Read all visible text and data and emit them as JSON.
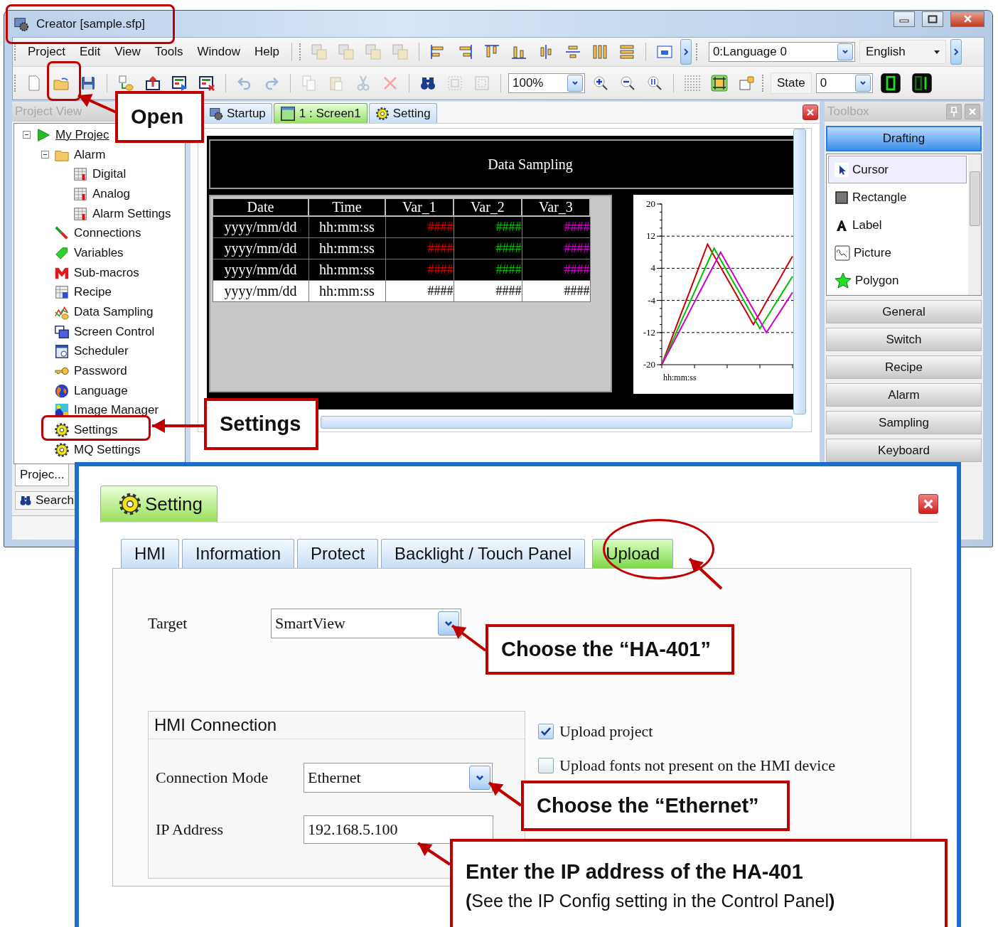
{
  "window": {
    "title": "Creator [sample.sfp]"
  },
  "menu": [
    "Project",
    "Edit",
    "View",
    "Tools",
    "Window",
    "Help"
  ],
  "language_select": {
    "value": "0:Language 0"
  },
  "locale_select": {
    "value": "English"
  },
  "zoom_select": {
    "value": "100%"
  },
  "state_select": {
    "label": "State",
    "value": "0"
  },
  "project_view": {
    "title": "Project View",
    "tree": [
      {
        "label": "My Projec",
        "expanded": true,
        "children": [
          {
            "label": "Alarm",
            "expanded": true,
            "children": [
              {
                "label": "Digital"
              },
              {
                "label": "Analog"
              },
              {
                "label": "Alarm Settings"
              }
            ]
          },
          {
            "label": "Connections"
          },
          {
            "label": "Variables"
          },
          {
            "label": "Sub-macros"
          },
          {
            "label": "Recipe"
          },
          {
            "label": "Data Sampling"
          },
          {
            "label": "Screen Control"
          },
          {
            "label": "Scheduler"
          },
          {
            "label": "Password"
          },
          {
            "label": "Language"
          },
          {
            "label": "Image Manager"
          },
          {
            "label": "Settings"
          },
          {
            "label": "MQ Settings"
          }
        ]
      }
    ],
    "tabs": [
      {
        "label": "Projec...",
        "selected": true
      }
    ],
    "search_tab": {
      "label": "Search"
    }
  },
  "editor": {
    "tabs": [
      {
        "label": "Startup",
        "selected": false
      },
      {
        "label": "1 : Screen1",
        "selected": true
      },
      {
        "label": "Setting",
        "selected": false
      }
    ],
    "screen": {
      "title": "Data Sampling",
      "table": {
        "columns": [
          {
            "label": "Date"
          },
          {
            "label": "Time"
          },
          {
            "label": "Var_1",
            "color": "#cc0000"
          },
          {
            "label": "Var_2",
            "color": "#00c000"
          },
          {
            "label": "Var_3",
            "color": "#cc00cc"
          }
        ],
        "rows": [
          {
            "cells": [
              "yyyy/mm/dd",
              "hh:mm:ss",
              "####",
              "####",
              "####"
            ],
            "highlighted": true
          },
          {
            "cells": [
              "yyyy/mm/dd",
              "hh:mm:ss",
              "####",
              "####",
              "####"
            ],
            "highlighted": true
          },
          {
            "cells": [
              "yyyy/mm/dd",
              "hh:mm:ss",
              "####",
              "####",
              "####"
            ],
            "highlighted": true
          },
          {
            "cells": [
              "yyyy/mm/dd",
              "hh:mm:ss",
              "####",
              "####",
              "####"
            ],
            "highlighted": false
          }
        ]
      },
      "chart_data": {
        "type": "line",
        "xlabel": "hh:mm:ss",
        "categories": [
          null,
          null,
          null,
          null,
          null,
          null,
          null,
          null,
          null,
          null,
          null,
          null,
          null,
          null,
          null,
          null,
          null,
          null,
          null,
          null,
          null
        ],
        "ylim": [
          -20,
          20
        ],
        "yticks": [
          20,
          12,
          4,
          -4,
          -12,
          -20
        ],
        "grid": true,
        "series": [
          {
            "color": "#cc0000",
            "values": [
              -20,
              -15.7,
              -11.4,
              -7.1,
              -2.9,
              1.4,
              5.7,
              10,
              7.1,
              4.3,
              1.4,
              -1.4,
              -4.3,
              -7.1,
              -10,
              -7.2,
              -4.3,
              -1.5,
              1.3,
              4.2,
              7
            ]
          },
          {
            "color": "#00c000",
            "values": [
              -20,
              -16.4,
              -12.8,
              -9.1,
              -5.5,
              -1.9,
              1.8,
              5.4,
              9,
              6.1,
              3.3,
              0.4,
              -2.4,
              -5.3,
              -8.1,
              -11,
              -8.4,
              -5.8,
              -3.2,
              -0.6,
              2
            ]
          },
          {
            "color": "#cc00cc",
            "values": [
              -20,
              -16.9,
              -13.8,
              -10.7,
              -7.6,
              -4.4,
              -1.3,
              1.8,
              4.9,
              8,
              5.1,
              2.3,
              -0.6,
              -3.4,
              -6.3,
              -9.1,
              -12,
              -9.5,
              -7,
              -4.5,
              -2
            ]
          }
        ]
      }
    }
  },
  "toolbox": {
    "title": "Toolbox",
    "categories": [
      {
        "label": "Drafting",
        "selected": true
      },
      {
        "label": "General",
        "selected": false
      },
      {
        "label": "Switch",
        "selected": false
      },
      {
        "label": "Recipe",
        "selected": false
      },
      {
        "label": "Alarm",
        "selected": false
      },
      {
        "label": "Sampling",
        "selected": false
      },
      {
        "label": "Keyboard",
        "selected": false
      }
    ],
    "tools": [
      {
        "label": "Cursor",
        "selected": true
      },
      {
        "label": "Rectangle",
        "selected": false
      },
      {
        "label": "Label",
        "selected": false
      },
      {
        "label": "Picture",
        "selected": false
      },
      {
        "label": "Polygon",
        "selected": false
      }
    ]
  },
  "settings_dialog": {
    "title": "Setting",
    "tabs": [
      {
        "label": "HMI",
        "selected": false
      },
      {
        "label": "Information",
        "selected": false
      },
      {
        "label": "Protect",
        "selected": false
      },
      {
        "label": "Backlight / Touch Panel",
        "selected": false
      },
      {
        "label": "Upload",
        "selected": true
      }
    ],
    "target": {
      "label": "Target",
      "value": "SmartView"
    },
    "connection": {
      "title": "HMI Connection",
      "mode": {
        "label": "Connection Mode",
        "value": "Ethernet"
      },
      "ip": {
        "label": "IP Address",
        "value": "192.168.5.100"
      }
    },
    "options": [
      {
        "label": "Upload project",
        "checked": true
      },
      {
        "label": "Upload fonts not present on the HMI device",
        "checked": false
      }
    ]
  },
  "callouts": [
    {
      "text": "Open"
    },
    {
      "text": "Settings"
    },
    {
      "text": "Choose the “HA-401”"
    },
    {
      "text": "Choose the “Ethernet”"
    },
    {
      "text": "Enter the IP address of the HA-401",
      "note": "**(**See the IP Config setting in the Control Panel**)**"
    }
  ]
}
